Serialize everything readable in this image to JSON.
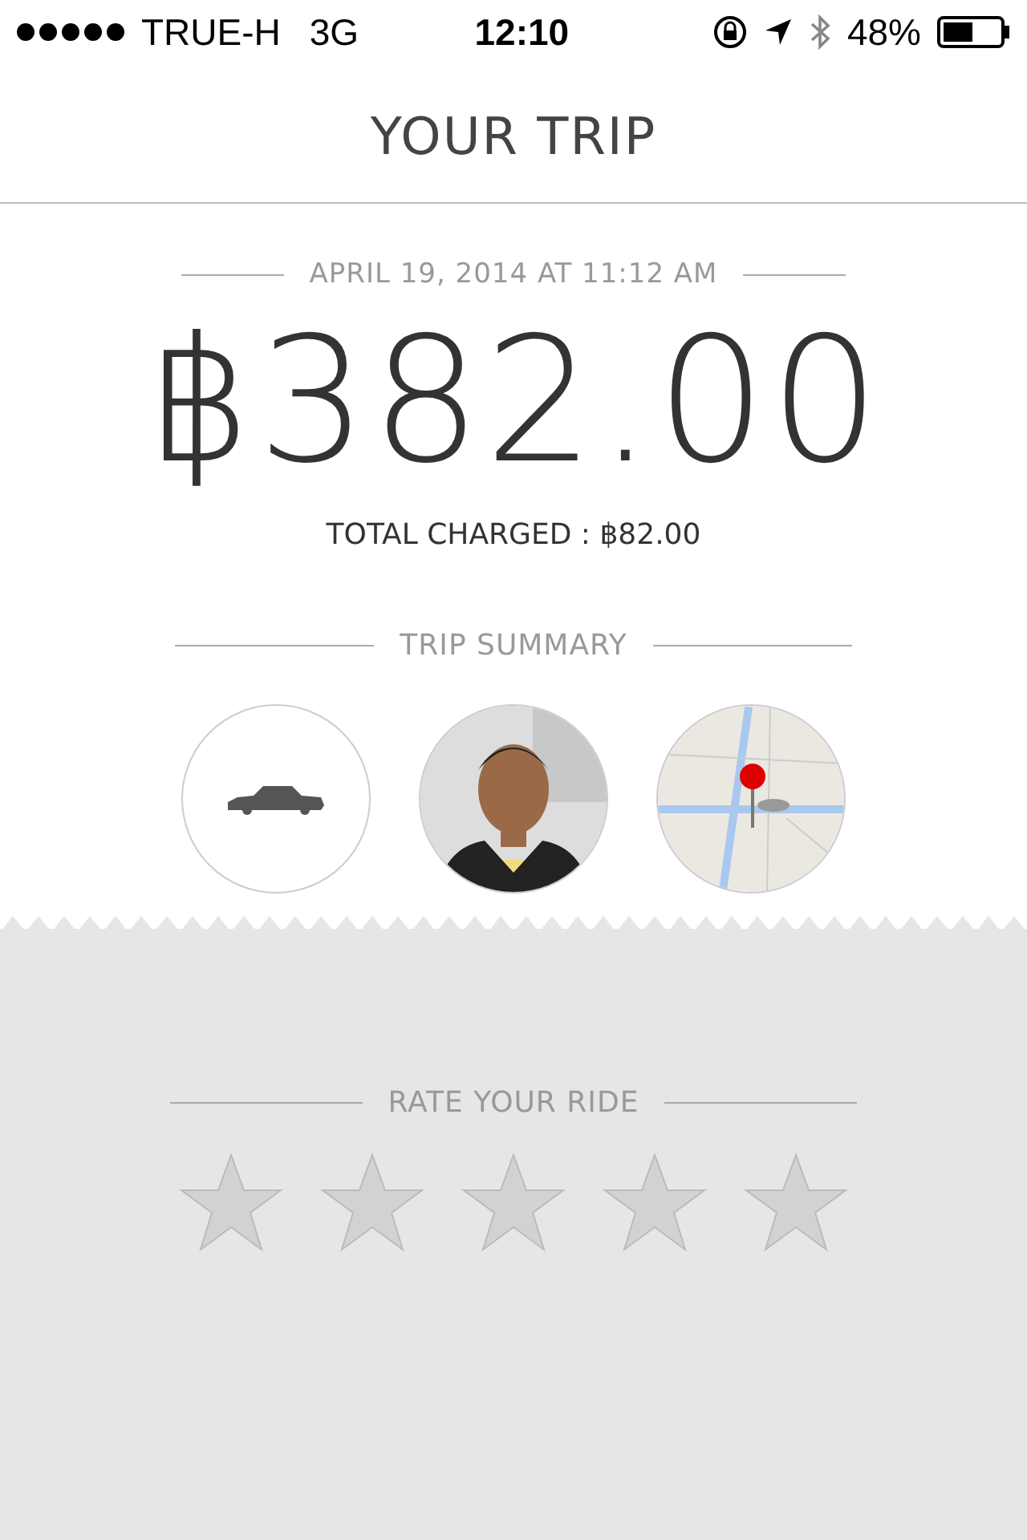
{
  "status_bar": {
    "carrier": "TRUE-H",
    "network": "3G",
    "time": "12:10",
    "battery": "48%"
  },
  "title": "YOUR TRIP",
  "date": "APRIL 19, 2014 AT 11:12 AM",
  "fare": "฿382.00",
  "total_charged": "TOTAL CHARGED : ฿82.00",
  "summary": {
    "heading": "TRIP SUMMARY",
    "items": [
      {
        "kind": "vehicle"
      },
      {
        "kind": "driver"
      },
      {
        "kind": "map"
      }
    ]
  },
  "rating": {
    "heading": "RATE YOUR RIDE",
    "stars": 0
  }
}
